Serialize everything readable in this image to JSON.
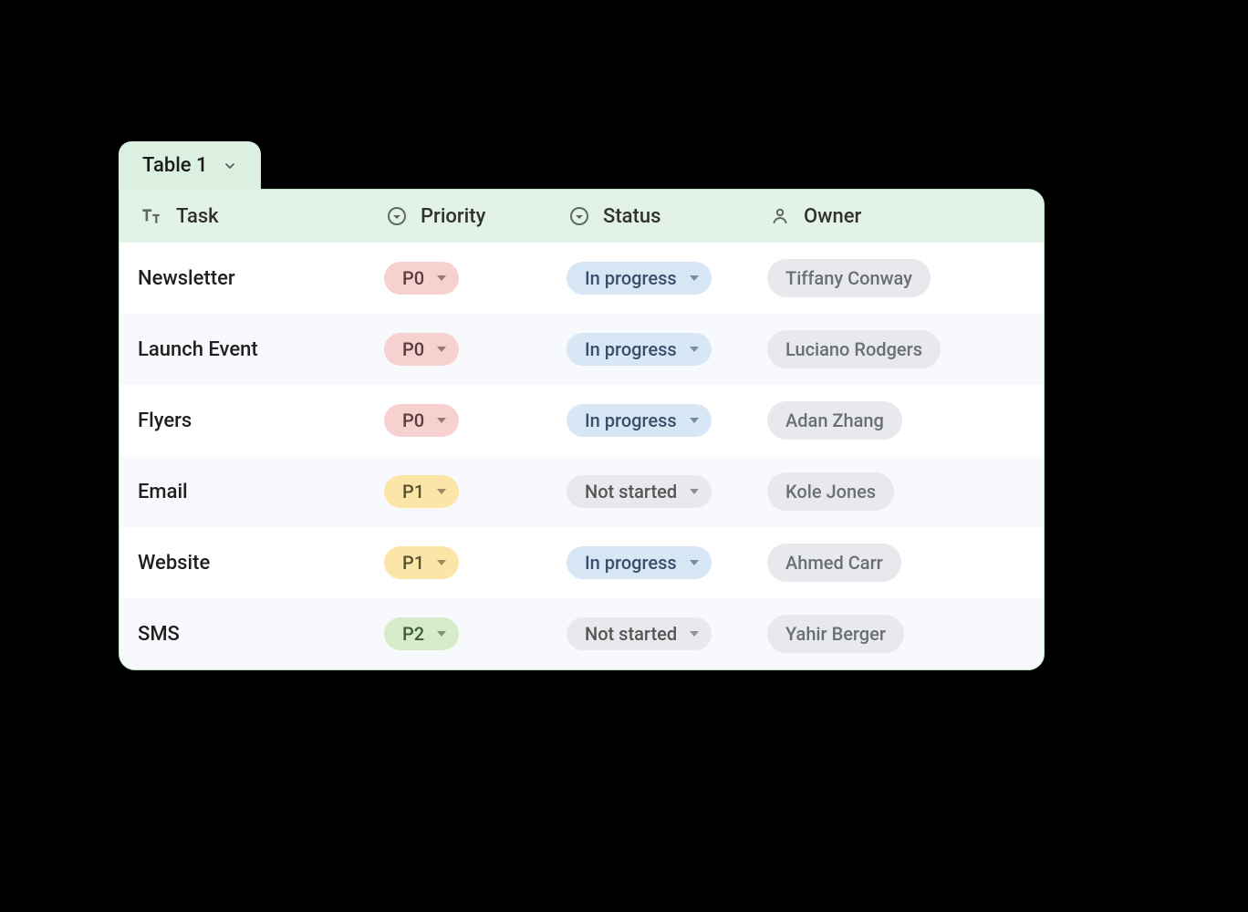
{
  "tab_label": "Table 1",
  "columns": {
    "task": "Task",
    "prio": "Priority",
    "status": "Status",
    "owner": "Owner"
  },
  "rows": [
    {
      "task": "Newsletter",
      "priority": "P0",
      "status": "In progress",
      "owner": "Tiffany Conway"
    },
    {
      "task": "Launch Event",
      "priority": "P0",
      "status": "In progress",
      "owner": "Luciano Rodgers"
    },
    {
      "task": "Flyers",
      "priority": "P0",
      "status": "In progress",
      "owner": "Adan Zhang"
    },
    {
      "task": "Email",
      "priority": "P1",
      "status": "Not started",
      "owner": "Kole Jones"
    },
    {
      "task": "Website",
      "priority": "P1",
      "status": "In progress",
      "owner": "Ahmed Carr"
    },
    {
      "task": "SMS",
      "priority": "P2",
      "status": "Not started",
      "owner": "Yahir Berger"
    }
  ],
  "style": {
    "priority_classes": {
      "P0": "prio-p0",
      "P1": "prio-p1",
      "P2": "prio-p2"
    },
    "status_classes": {
      "In progress": "stat-inprogress",
      "Not started": "stat-notstarted"
    }
  }
}
